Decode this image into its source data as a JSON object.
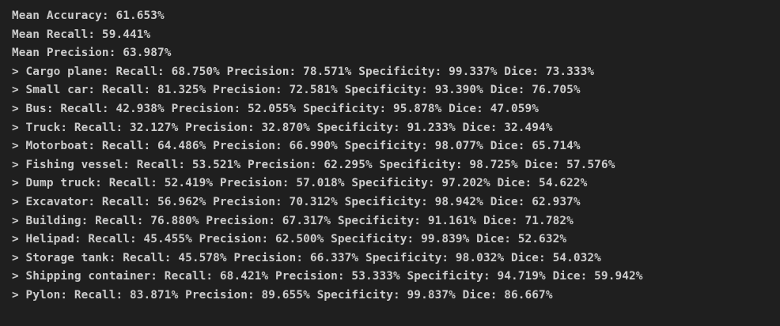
{
  "output": {
    "summary": [
      "Mean Accuracy: 61.653%",
      "Mean Recall: 59.441%",
      "Mean Precision: 63.987%"
    ],
    "classes": [
      "> Cargo plane: Recall: 68.750% Precision: 78.571% Specificity: 99.337% Dice: 73.333%",
      "> Small car: Recall: 81.325% Precision: 72.581% Specificity: 93.390% Dice: 76.705%",
      "> Bus: Recall: 42.938% Precision: 52.055% Specificity: 95.878% Dice: 47.059%",
      "> Truck: Recall: 32.127% Precision: 32.870% Specificity: 91.233% Dice: 32.494%",
      "> Motorboat: Recall: 64.486% Precision: 66.990% Specificity: 98.077% Dice: 65.714%",
      "> Fishing vessel: Recall: 53.521% Precision: 62.295% Specificity: 98.725% Dice: 57.576%",
      "> Dump truck: Recall: 52.419% Precision: 57.018% Specificity: 97.202% Dice: 54.622%",
      "> Excavator: Recall: 56.962% Precision: 70.312% Specificity: 98.942% Dice: 62.937%",
      "> Building: Recall: 76.880% Precision: 67.317% Specificity: 91.161% Dice: 71.782%",
      "> Helipad: Recall: 45.455% Precision: 62.500% Specificity: 99.839% Dice: 52.632%",
      "> Storage tank: Recall: 45.578% Precision: 66.337% Specificity: 98.032% Dice: 54.032%",
      "> Shipping container: Recall: 68.421% Precision: 53.333% Specificity: 94.719% Dice: 59.942%",
      "> Pylon: Recall: 83.871% Precision: 89.655% Specificity: 99.837% Dice: 86.667%"
    ]
  },
  "colors": {
    "background": "#1f1f1f",
    "text": "#cccccc"
  }
}
